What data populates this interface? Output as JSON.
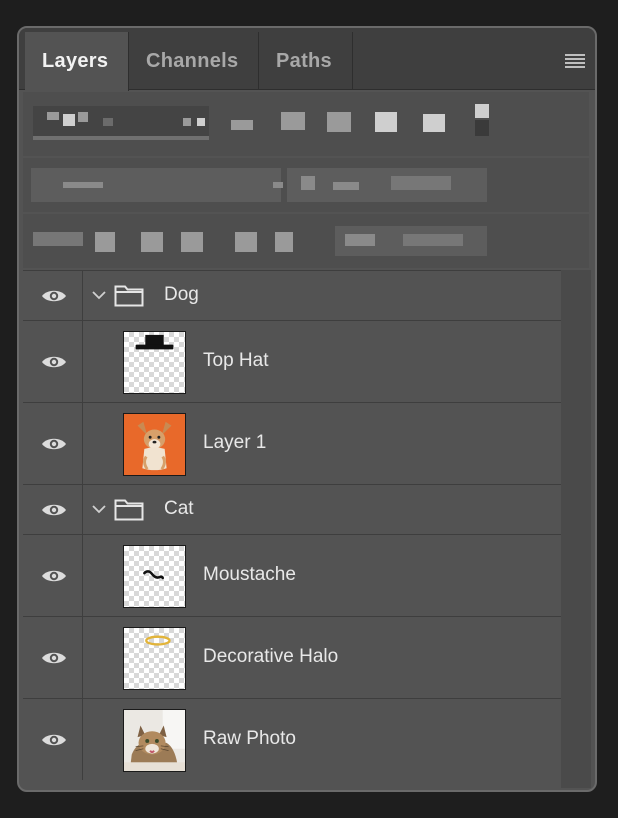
{
  "panel": {
    "tabs": [
      {
        "label": "Layers",
        "active": true
      },
      {
        "label": "Channels",
        "active": false
      },
      {
        "label": "Paths",
        "active": false
      }
    ]
  },
  "layers": [
    {
      "type": "group",
      "name": "Dog",
      "visible": true,
      "expanded": true,
      "icon": "folder-icon"
    },
    {
      "type": "layer",
      "name": "Top Hat",
      "visible": true,
      "thumbnail": "top-hat",
      "transparent": true
    },
    {
      "type": "layer",
      "name": "Layer 1",
      "visible": true,
      "thumbnail": "dog-photo",
      "transparent": false
    },
    {
      "type": "group",
      "name": "Cat",
      "visible": true,
      "expanded": true,
      "icon": "folder-icon"
    },
    {
      "type": "layer",
      "name": "Moustache",
      "visible": true,
      "thumbnail": "moustache",
      "transparent": true
    },
    {
      "type": "layer",
      "name": "Decorative Halo",
      "visible": true,
      "thumbnail": "halo",
      "transparent": true
    },
    {
      "type": "layer",
      "name": "Raw Photo",
      "visible": true,
      "thumbnail": "cat-photo",
      "transparent": false
    }
  ],
  "colors": {
    "panel_bg": "#535353",
    "tabbar_bg": "#3f3f3f",
    "text": "#e8e8e8",
    "dog_bg": "#e8692a",
    "halo": "#e2b43a"
  }
}
